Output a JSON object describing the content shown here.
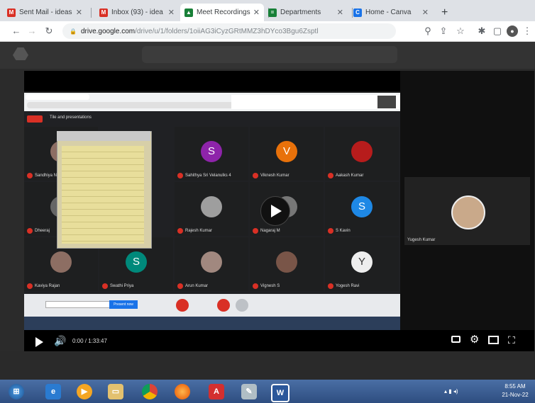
{
  "browser": {
    "tabs": [
      {
        "label": "Sent Mail - ideas",
        "favicon": "gmail-icon",
        "color": "#d93025",
        "glyph": "M"
      },
      {
        "label": "Inbox (93) - idea",
        "favicon": "gmail-icon",
        "color": "#d93025",
        "glyph": "M"
      },
      {
        "label": "Meet Recordings",
        "favicon": "drive-icon",
        "color": "#188038",
        "glyph": "▲"
      },
      {
        "label": "Departments",
        "favicon": "sheets-icon",
        "color": "#188038",
        "glyph": "="
      },
      {
        "label": "Home - Canva",
        "favicon": "canva-icon",
        "color": "#1a73e8",
        "glyph": "C"
      }
    ],
    "new_tab": "+",
    "url_domain": "drive.google.com",
    "url_path": "/drive/u/1/folders/1oiiAG3iCyzGRtMMZ3hDYco3Bgu6Zsptl"
  },
  "player": {
    "time": "0:00 / 1:33:47",
    "right_tile_name": "Yugesh Kumar"
  },
  "meet": {
    "header_title": "Tile and presentations",
    "participants": [
      {
        "name": "Sandhiya N",
        "initial": "",
        "color": "#8d6e63"
      },
      {
        "name": "Sahithya Sri Velanulks 4",
        "initial": "S",
        "color": "#8e24aa"
      },
      {
        "name": "Viknesh Kumar",
        "initial": "V",
        "color": "#e8710a"
      },
      {
        "name": "Aakash Kumar",
        "initial": "",
        "color": "#b71c1c"
      },
      {
        "name": "Dheeraj",
        "initial": "",
        "color": "#666"
      },
      {
        "name": "Rajesh Kumar",
        "initial": "",
        "color": "#9e9e9e"
      },
      {
        "name": "Nagaraj M",
        "initial": "",
        "color": "#777"
      },
      {
        "name": "S Kavin",
        "initial": "S",
        "color": "#1e88e5"
      },
      {
        "name": "Kaviya Rajan",
        "initial": "",
        "color": "#8d6e63"
      },
      {
        "name": "Swathi Priya",
        "initial": "S",
        "color": "#00897b"
      },
      {
        "name": "Arun Kumar",
        "initial": "",
        "color": "#a1887f"
      },
      {
        "name": "Vignesh S",
        "initial": "",
        "color": "#795548"
      },
      {
        "name": "Yogesh Ravi",
        "initial": "Y",
        "color": "#eeeeee"
      }
    ],
    "present_label": "Present now"
  },
  "taskbar": {
    "time": "8:55 AM",
    "date": "21-Nov-22"
  }
}
